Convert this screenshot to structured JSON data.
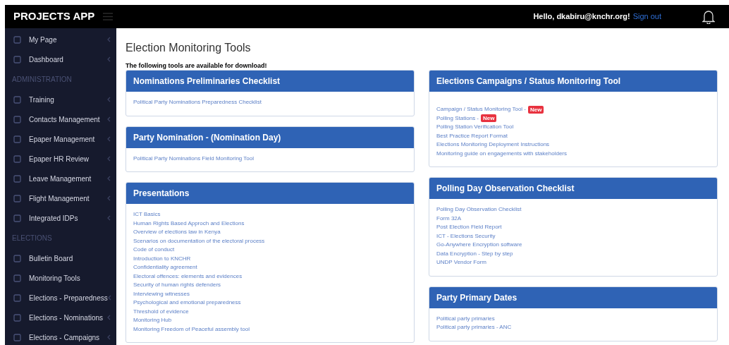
{
  "app": {
    "title": "PROJECTS APP",
    "greeting": "Hello, dkabiru@knchr.org!",
    "sign_out": "Sign out"
  },
  "sidebar": {
    "items": [
      {
        "kind": "item",
        "label": "My Page",
        "submenu": true
      },
      {
        "kind": "item",
        "label": "Dashboard",
        "submenu": true
      },
      {
        "kind": "header",
        "label": "ADMINISTRATION"
      },
      {
        "kind": "item",
        "label": "Training",
        "submenu": true
      },
      {
        "kind": "item",
        "label": "Contacts Management",
        "submenu": true
      },
      {
        "kind": "item",
        "label": "Epaper Management",
        "submenu": true
      },
      {
        "kind": "item",
        "label": "Epaper HR Review",
        "submenu": true
      },
      {
        "kind": "item",
        "label": "Leave Management",
        "submenu": true
      },
      {
        "kind": "item",
        "label": "Flight Management",
        "submenu": true
      },
      {
        "kind": "item",
        "label": "Integrated IDPs",
        "submenu": true
      },
      {
        "kind": "header",
        "label": "ELECTIONS"
      },
      {
        "kind": "item",
        "label": "Bulletin Board",
        "submenu": false
      },
      {
        "kind": "item",
        "label": "Monitoring Tools",
        "submenu": false
      },
      {
        "kind": "item",
        "label": "Elections - Preparedness",
        "submenu": true
      },
      {
        "kind": "item",
        "label": "Elections - Nominations",
        "submenu": true
      },
      {
        "kind": "item",
        "label": "Elections - Campaigns",
        "submenu": true
      }
    ]
  },
  "page": {
    "title": "Election Monitoring Tools",
    "intro": "The following tools are available for download!"
  },
  "columns": [
    {
      "cards": [
        {
          "title": "Nominations Preliminaries Checklist",
          "links": [
            {
              "label": "Political Party Nominations Preparedness Checklist"
            }
          ]
        },
        {
          "title": "Party Nomination - (Nomination Day)",
          "links": [
            {
              "label": "Political Party Nominations Field Monitoring Tool"
            }
          ]
        },
        {
          "title": "Presentations",
          "links": [
            {
              "label": "ICT Basics"
            },
            {
              "label": "Human Rights Based Approch and Elections"
            },
            {
              "label": "Overview of elections law in Kenya"
            },
            {
              "label": "Scenarios on documentation of the electoral process"
            },
            {
              "label": "Code of conduct"
            },
            {
              "label": "Introduction to KNCHR"
            },
            {
              "label": "Confidentiality agreement"
            },
            {
              "label": "Electoral offences: elements and evidences"
            },
            {
              "label": "Security of human rights defenders"
            },
            {
              "label": "Interviewing witnesses"
            },
            {
              "label": "Psychological and emotional preparedness"
            },
            {
              "label": "Threshold of evidence"
            },
            {
              "label": "Monitoring Hub"
            },
            {
              "label": "Monitoring Freedom of Peaceful assembly tool"
            }
          ]
        }
      ]
    },
    {
      "cards": [
        {
          "title": "Elections Campaigns / Status Monitoring Tool",
          "links": [
            {
              "label": "Campaign / Status Monitoring Tool -",
              "badge": "New"
            },
            {
              "label": "Polling Stations -",
              "badge": "New"
            },
            {
              "label": "Polling Station Verification Tool"
            },
            {
              "label": "Best Practice Report Format"
            },
            {
              "label": "Elections Monitoring Deployment Instructions"
            },
            {
              "label": "Monitoring guide on engagements with stakeholders"
            }
          ]
        },
        {
          "title": "Polling Day Observation Checklist",
          "links": [
            {
              "label": "Polling Day Observation Checklist"
            },
            {
              "label": "Form 32A"
            },
            {
              "label": "Post Election Field Report"
            },
            {
              "label": "ICT - Elections Security"
            },
            {
              "label": "Go-Anywhere Encryption software"
            },
            {
              "label": "Data Encryption - Step by step"
            },
            {
              "label": "UNDP Vendor Form"
            }
          ]
        },
        {
          "title": "Party Primary Dates",
          "links": [
            {
              "label": "Political party primaries"
            },
            {
              "label": "Political party primaries - ANC"
            }
          ]
        }
      ]
    }
  ]
}
